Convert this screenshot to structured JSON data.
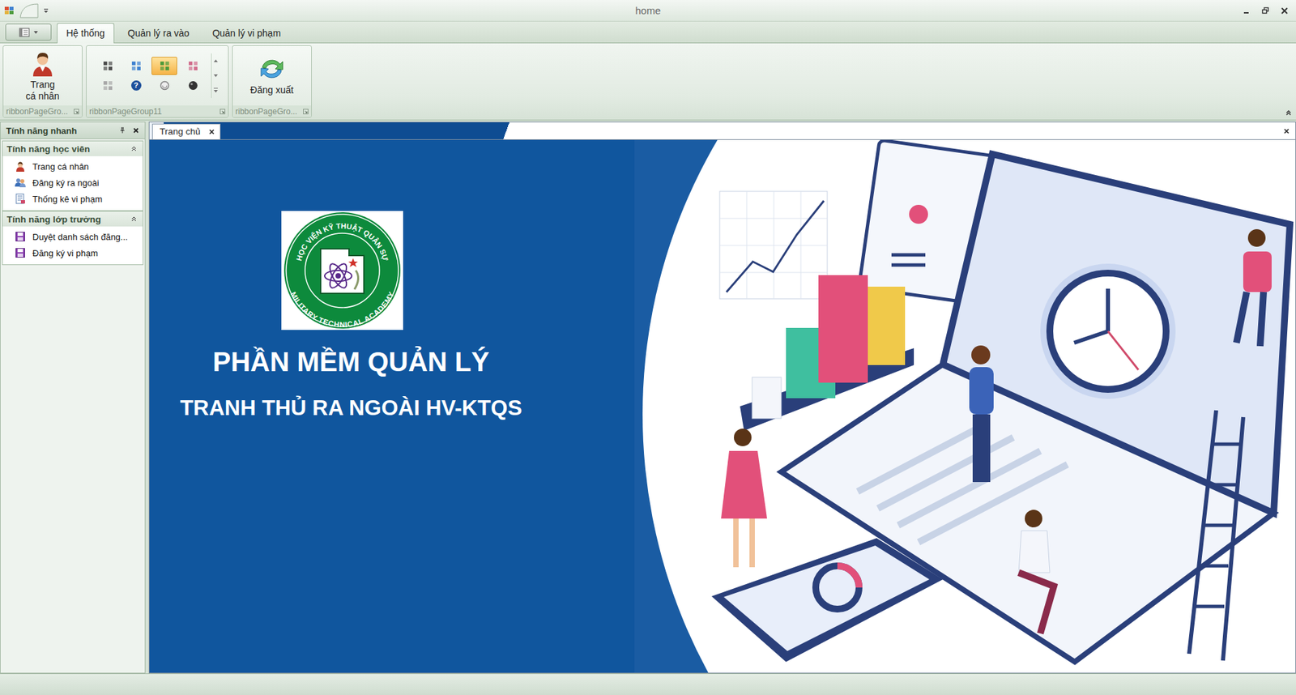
{
  "window": {
    "title": "home"
  },
  "ribbon": {
    "tabs": [
      {
        "label": "Hệ thống",
        "selected": true
      },
      {
        "label": "Quản lý ra vào",
        "selected": false
      },
      {
        "label": "Quản lý vi phạm",
        "selected": false
      }
    ],
    "groups": [
      {
        "kind": "profile",
        "caption": "ribbonPageGro...",
        "button": "Trang cá nhân"
      },
      {
        "kind": "gallery",
        "caption": "ribbonPageGroup11",
        "items": [
          {
            "kind": "grid",
            "color": "#4a4a4a",
            "selected": false
          },
          {
            "kind": "grid",
            "color": "#3b7fd0",
            "selected": false
          },
          {
            "kind": "grid",
            "color": "#4a9a3a",
            "selected": true
          },
          {
            "kind": "grid",
            "color": "#d06a8a",
            "selected": false
          },
          {
            "kind": "grid",
            "color": "#a8a8a8",
            "selected": false
          },
          {
            "kind": "help",
            "color": "#1d4f9a",
            "glyph": "?",
            "selected": false
          },
          {
            "kind": "ring",
            "color": "#8a8a8a",
            "selected": false
          },
          {
            "kind": "disc",
            "color": "#333333",
            "selected": false
          }
        ]
      },
      {
        "kind": "logout",
        "caption": "ribbonPageGro...",
        "button": "Đăng xuất"
      }
    ]
  },
  "quick_panel": {
    "title": "Tính năng nhanh",
    "groups": [
      {
        "title": "Tính năng học viên",
        "expanded": true,
        "items": [
          {
            "label": "Trang cá nhân",
            "kind": "user"
          },
          {
            "label": "Đăng ký ra ngoài",
            "kind": "users"
          },
          {
            "label": "Thống kê vi phạm",
            "kind": "report"
          }
        ]
      },
      {
        "title": "Tính năng lớp trưởng",
        "expanded": true,
        "items": [
          {
            "label": "Duyệt danh sách đăng...",
            "kind": "form"
          },
          {
            "label": "Đăng ký vi phạm",
            "kind": "form"
          }
        ]
      }
    ]
  },
  "documents": {
    "tabs": [
      {
        "label": "Trang chủ",
        "selected": true
      }
    ]
  },
  "banner": {
    "title": "PHẦN MỀM QUẢN LÝ",
    "subtitle": "TRANH THỦ RA NGOÀI HV-KTQS",
    "logo": {
      "top": "HỌC VIỆN KỸ THUẬT QUÂN SỰ",
      "bottom": "MILITARY TECHNICAL ACADEMY"
    }
  }
}
